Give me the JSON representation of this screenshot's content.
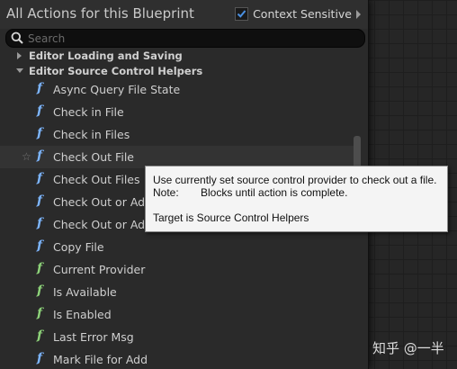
{
  "header": {
    "title": "All Actions for this Blueprint",
    "context_sensitive_label": "Context Sensitive",
    "context_sensitive_checked": true
  },
  "search": {
    "placeholder": "Search",
    "value": ""
  },
  "categories": [
    {
      "label": "Editor Loading and Saving",
      "expanded": false
    },
    {
      "label": "Editor Source Control Helpers",
      "expanded": true
    }
  ],
  "items": [
    {
      "label": "Async Query File State",
      "icon": "function-icon",
      "icon_color": "#7db6ff"
    },
    {
      "label": "Check in File",
      "icon": "function-icon",
      "icon_color": "#7db6ff"
    },
    {
      "label": "Check in Files",
      "icon": "function-icon",
      "icon_color": "#7db6ff"
    },
    {
      "label": "Check Out File",
      "icon": "function-icon",
      "icon_color": "#7db6ff"
    },
    {
      "label": "Check Out Files",
      "icon": "function-icon",
      "icon_color": "#7db6ff"
    },
    {
      "label": "Check Out or Add",
      "icon": "function-icon",
      "icon_color": "#7db6ff"
    },
    {
      "label": "Check Out or Add",
      "icon": "function-icon",
      "icon_color": "#7db6ff"
    },
    {
      "label": "Copy File",
      "icon": "function-icon",
      "icon_color": "#7db6ff"
    },
    {
      "label": "Current Provider",
      "icon": "pure-function-icon",
      "icon_color": "#8ed47a"
    },
    {
      "label": "Is Available",
      "icon": "pure-function-icon",
      "icon_color": "#8ed47a"
    },
    {
      "label": "Is Enabled",
      "icon": "pure-function-icon",
      "icon_color": "#8ed47a"
    },
    {
      "label": "Last Error Msg",
      "icon": "pure-function-icon",
      "icon_color": "#8ed47a"
    },
    {
      "label": "Mark File for Add",
      "icon": "function-icon",
      "icon_color": "#7db6ff"
    }
  ],
  "hovered_item": "Check Out File",
  "tooltip": {
    "line1": "Use currently set source control provider to check out a file.",
    "note_label": "Note:",
    "note_value": "Blocks until action is complete.",
    "target": "Target is Source Control Helpers"
  },
  "watermark": "知乎 @一半",
  "colors": {
    "accent": "#4a90e2",
    "function_icon": "#7db6ff",
    "pure_function_icon": "#8ed47a"
  }
}
